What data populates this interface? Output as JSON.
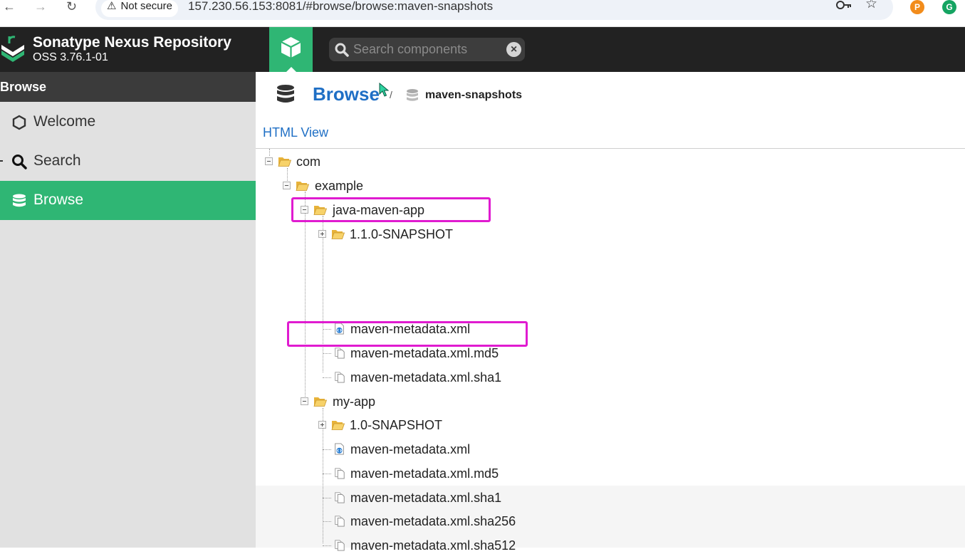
{
  "browser": {
    "security_label": "Not secure",
    "url": "157.230.56.153:8081/#browse/browse:maven-snapshots",
    "extension_p_label": "P",
    "extension_g_label": "G"
  },
  "header": {
    "title": "Sonatype Nexus Repository",
    "version": "OSS 3.76.1-01",
    "search_placeholder": "Search components",
    "brand_color": "#2fb674"
  },
  "sidebar": {
    "section_title": "Browse",
    "items": [
      {
        "label": "Welcome",
        "icon": "hexagon-icon",
        "active": false
      },
      {
        "label": "Search",
        "icon": "search-icon",
        "active": false
      },
      {
        "label": "Browse",
        "icon": "database-icon",
        "active": true
      }
    ]
  },
  "breadcrumb": {
    "root": "Browse",
    "separator": "/",
    "repository": "maven-snapshots"
  },
  "main": {
    "html_view_link": "HTML View"
  },
  "tree": {
    "nodes": [
      {
        "label": "com",
        "type": "folder",
        "expanded": true
      },
      {
        "label": "example",
        "type": "folder",
        "expanded": true
      },
      {
        "label": "java-maven-app",
        "type": "folder",
        "expanded": true,
        "highlighted": true
      },
      {
        "label": "1.1.0-SNAPSHOT",
        "type": "folder",
        "expanded": false
      },
      {
        "label": "maven-metadata.xml",
        "type": "xml-file"
      },
      {
        "label": "maven-metadata.xml.md5",
        "type": "file"
      },
      {
        "label": "maven-metadata.xml.sha1",
        "type": "file"
      },
      {
        "label": "my-app",
        "type": "folder",
        "expanded": true,
        "highlighted": true
      },
      {
        "label": "1.0-SNAPSHOT",
        "type": "folder",
        "expanded": false
      },
      {
        "label": "maven-metadata.xml",
        "type": "xml-file"
      },
      {
        "label": "maven-metadata.xml.md5",
        "type": "file"
      },
      {
        "label": "maven-metadata.xml.sha1",
        "type": "file"
      },
      {
        "label": "maven-metadata.xml.sha256",
        "type": "file"
      },
      {
        "label": "maven-metadata.xml.sha512",
        "type": "file"
      }
    ],
    "highlight_color": "#e01bd0"
  }
}
